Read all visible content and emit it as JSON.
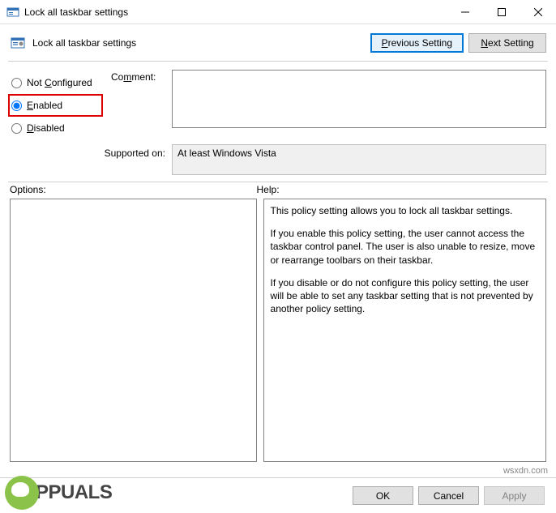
{
  "window": {
    "title": "Lock all taskbar settings"
  },
  "toolbar": {
    "title": "Lock all taskbar settings",
    "prev_label": "Previous Setting",
    "next_label": "Next Setting"
  },
  "radios": {
    "not_configured": "Not Configured",
    "enabled": "Enabled",
    "disabled": "Disabled",
    "selected": "enabled"
  },
  "comment": {
    "label": "Comment:",
    "value": ""
  },
  "supported": {
    "label": "Supported on:",
    "value": "At least Windows Vista"
  },
  "panels": {
    "options_label": "Options:",
    "help_label": "Help:",
    "help_p1": "This policy setting allows you to lock all taskbar settings.",
    "help_p2": "If you enable this policy setting, the user cannot access the taskbar control panel. The user is also unable to resize, move or rearrange toolbars on their taskbar.",
    "help_p3": "If you disable or do not configure this policy setting, the user will be able to set any taskbar setting that is not prevented by another policy setting."
  },
  "buttons": {
    "ok": "OK",
    "cancel": "Cancel",
    "apply": "Apply"
  },
  "watermark": {
    "text": "PPUALS",
    "credit": "wsxdn.com"
  }
}
